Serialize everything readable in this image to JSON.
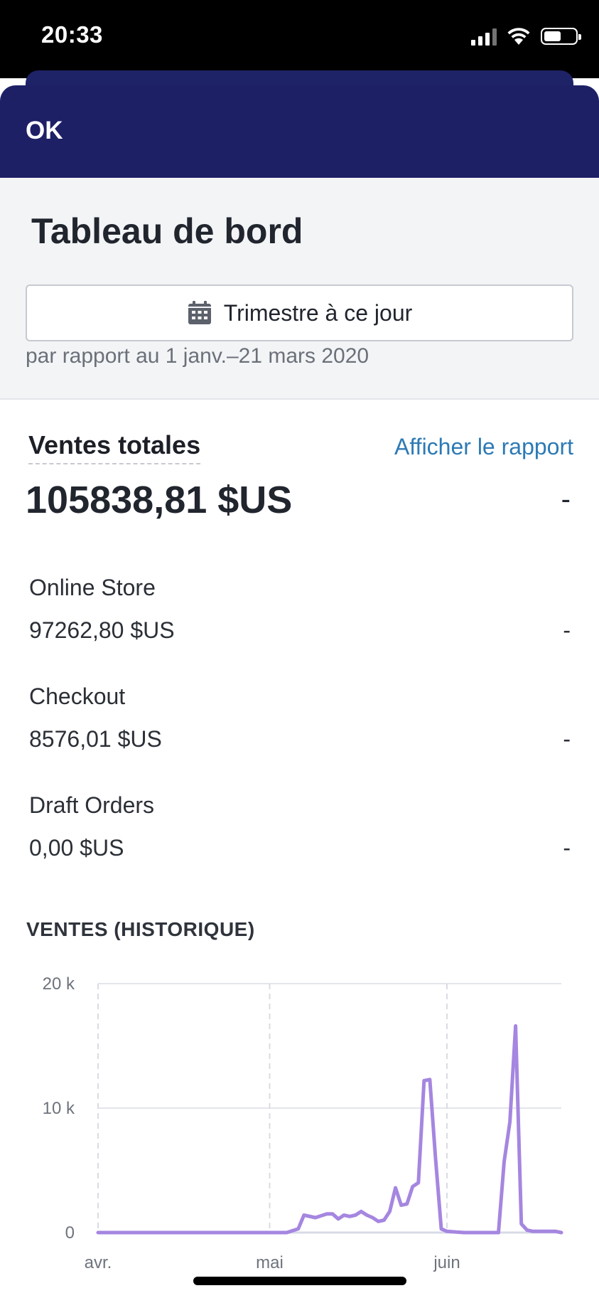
{
  "status_bar": {
    "time": "20:33"
  },
  "header": {
    "ok_label": "OK"
  },
  "dashboard": {
    "title": "Tableau de bord",
    "date_range_label": "Trimestre à ce jour",
    "comparison_text": "par rapport au 1 janv.–21 mars 2020"
  },
  "sales": {
    "title": "Ventes totales",
    "report_link": "Afficher le rapport",
    "total": "105838,81 $US",
    "total_change": "-",
    "channels": [
      {
        "name": "Online Store",
        "value": "97262,80 $US",
        "change": "-"
      },
      {
        "name": "Checkout",
        "value": "8576,01 $US",
        "change": "-"
      },
      {
        "name": "Draft Orders",
        "value": "0,00 $US",
        "change": "-"
      }
    ]
  },
  "chart_heading": "VENTES (HISTORIQUE)",
  "chart_data": {
    "type": "line",
    "title": "VENTES (HISTORIQUE)",
    "xlabel": "",
    "ylabel": "",
    "x_tick_labels": [
      "avr.",
      "mai",
      "juin"
    ],
    "y_tick_labels": [
      "20 k",
      "10 k",
      "0"
    ],
    "y_ticks": [
      20000,
      10000,
      0
    ],
    "ylim": [
      0,
      20000
    ],
    "xlim": [
      0,
      81
    ],
    "x_tick_positions": [
      0,
      30,
      61
    ],
    "grid": true,
    "color": "#a586e0",
    "series": [
      {
        "x": [
          0,
          33,
          35,
          36,
          38,
          40,
          41,
          42,
          43,
          44,
          45,
          46,
          47,
          48,
          49,
          50,
          51,
          52,
          53,
          54,
          55,
          56,
          57,
          58,
          59,
          60,
          61,
          64,
          70,
          71,
          72,
          73,
          74,
          75,
          76,
          78,
          80,
          81
        ],
        "y": [
          0,
          0,
          300,
          1400,
          1200,
          1500,
          1500,
          1100,
          1400,
          1300,
          1400,
          1700,
          1400,
          1200,
          900,
          1000,
          1700,
          3600,
          2200,
          2300,
          3700,
          4000,
          12200,
          12300,
          6000,
          300,
          100,
          0,
          0,
          5700,
          8900,
          16600,
          700,
          200,
          100,
          100,
          100,
          0
        ]
      }
    ]
  }
}
